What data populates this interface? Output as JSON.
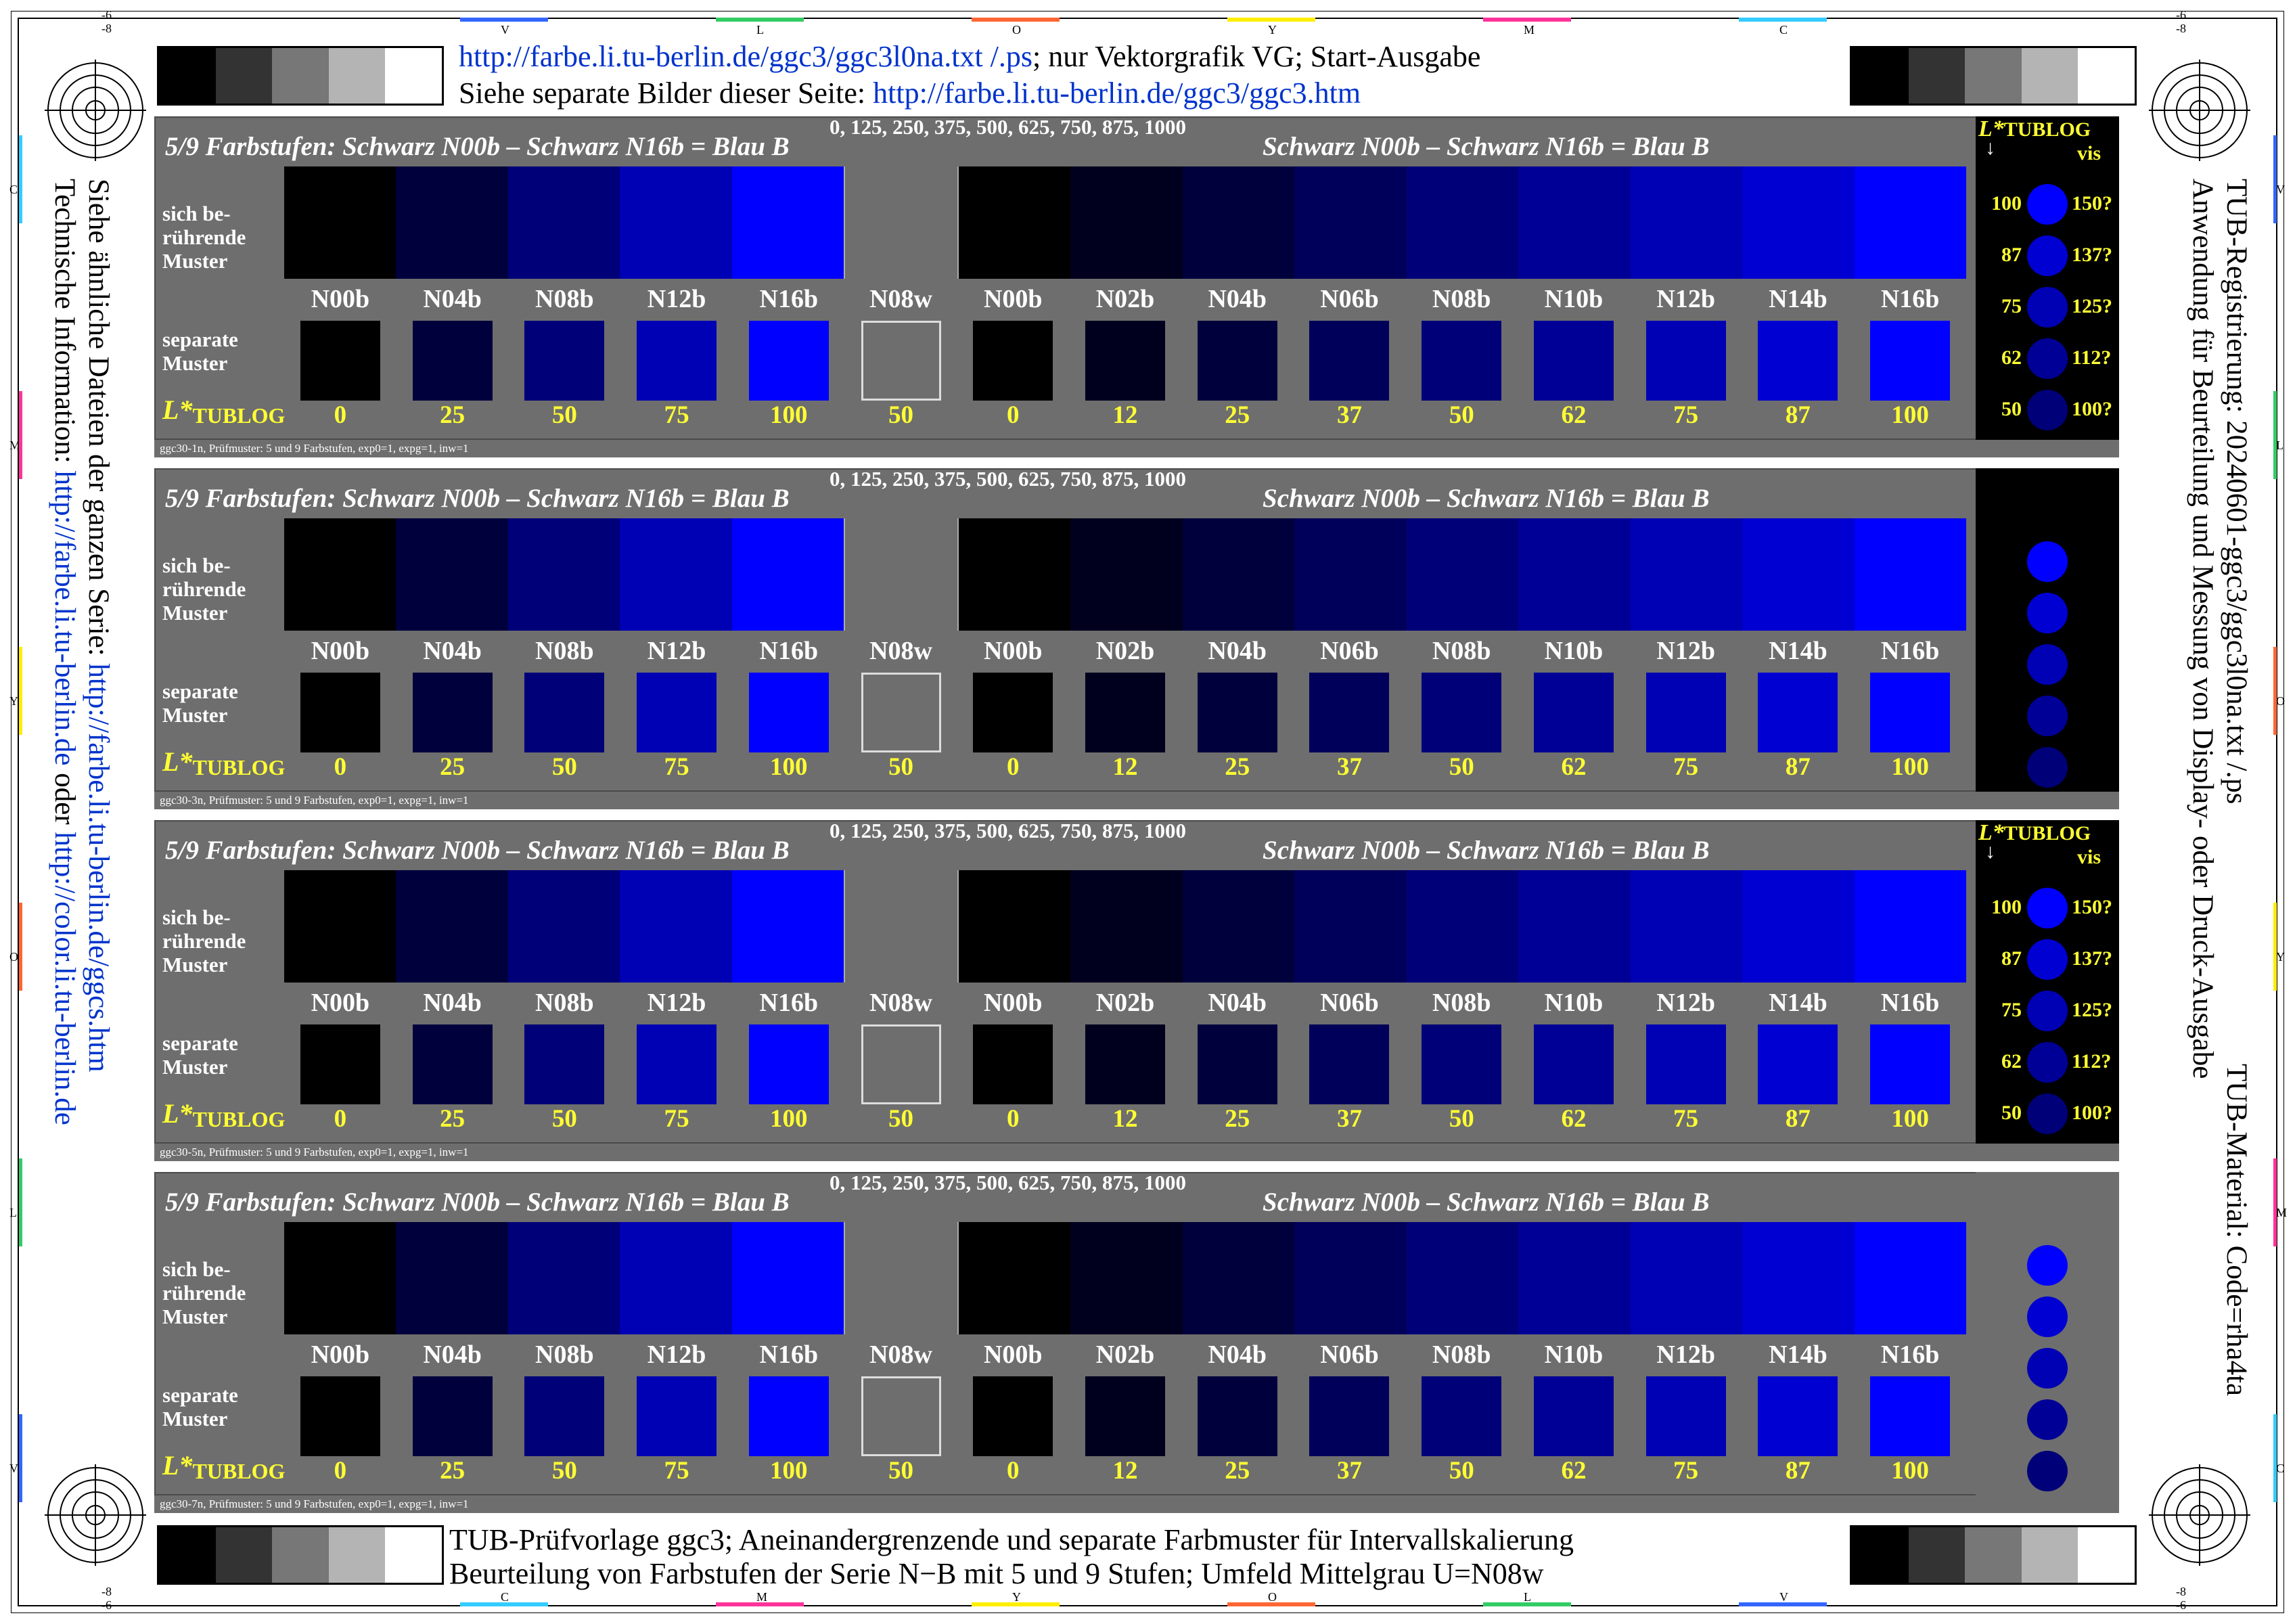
{
  "header": {
    "line1_link": "http://farbe.li.tu-berlin.de/ggc3/ggc3l0na.txt /.ps",
    "line1_rest": "; nur Vektorgrafik VG; Start-Ausgabe",
    "line2_text": "Siehe separate Bilder dieser Seite: ",
    "line2_link": "http://farbe.li.tu-berlin.de/ggc3/ggc3.htm"
  },
  "footer": {
    "line1": "TUB-Prüfvorlage ggc3; Aneinandergrenzende und separate Farbmuster für Intervallskalierung",
    "line2": "Beurteilung von Farbstufen der Serie N−B mit 5 und 9 Stufen; Umfeld Mittelgrau U=N08w"
  },
  "left_side": {
    "line1_text": "Siehe ähnliche Dateien der ganzen Serie: ",
    "line1_link": "http://farbe.li.tu-berlin.de/ggcs.htm",
    "line2_text": "Technische Information: ",
    "line2_link1": "http://farbe.li.tu-berlin.de",
    "line2_mid": " oder ",
    "line2_link2": "http://color.li.tu-berlin.de"
  },
  "right_side": {
    "line1": "TUB-Registrierung: 20240601-ggc3/ggc3l0na.txt /.ps",
    "line2": "Anwendung für Beurteilung und Messung von Display- oder Druck-Ausgabe",
    "line3": "TUB-Material: Code=rha4ta"
  },
  "marks": {
    "corner_a": "-6",
    "corner_b": "-8",
    "top_letters": [
      "V",
      "L",
      "O",
      "Y",
      "M",
      "C"
    ],
    "bottom_letters": [
      "C",
      "M",
      "Y",
      "O",
      "L",
      "V"
    ],
    "left_letters": [
      "C",
      "M",
      "Y",
      "O",
      "L",
      "V"
    ],
    "right_letters": [
      "V",
      "L",
      "O",
      "Y",
      "M",
      "C"
    ]
  },
  "panel_common": {
    "title_left": "5/9 Farbstufen:   Schwarz N00b – Schwarz N16b = Blau B",
    "title_right": "Schwarz N00b – Schwarz N16b = Blau B",
    "numbers": "0, 125, 250, 375, 500, 625, 750, 875, 1000",
    "label_contig": "sich be-\nrührende\nMuster",
    "label_sep": "separate\nMuster",
    "lstar_main": "L*",
    "lstar_sub": "TUBLOG",
    "labels": [
      "N00b",
      "N04b",
      "N08b",
      "N12b",
      "N16b",
      "N08w",
      "N00b",
      "N02b",
      "N04b",
      "N06b",
      "N08b",
      "N10b",
      "N12b",
      "N14b",
      "N16b"
    ],
    "values": [
      "0",
      "25",
      "50",
      "75",
      "100",
      "50",
      "0",
      "12",
      "25",
      "37",
      "50",
      "62",
      "75",
      "87",
      "100"
    ],
    "colors": [
      "#000000",
      "#00003c",
      "#000078",
      "#0000b4",
      "#0000ff",
      "#6e6e6e",
      "#000000",
      "#00001e",
      "#00003c",
      "#00005a",
      "#000078",
      "#000096",
      "#0000b4",
      "#0000d2",
      "#0000ff"
    ]
  },
  "panels": [
    {
      "footnote": "ggc30-1n, Prüfmuster: 5 und 9 Farbstufen, exp0=1, expg=1, inw=1",
      "side_labels": true
    },
    {
      "footnote": "ggc30-3n, Prüfmuster: 5 und 9 Farbstufen, exp0=1, expg=1, inw=1",
      "side_labels": false
    },
    {
      "footnote": "ggc30-5n, Prüfmuster: 5 und 9 Farbstufen, exp0=1, expg=1, inw=1",
      "side_labels": true
    },
    {
      "footnote": "ggc30-7n, Prüfmuster: 5 und 9 Farbstufen, exp0=1, expg=1, inw=1",
      "side_labels": false
    }
  ],
  "sidebox": {
    "title_main": "L*",
    "title_sub": "TUBLOG",
    "vis": "vis",
    "arrow": "↓",
    "left_vals": [
      "100",
      "87",
      "75",
      "62",
      "50"
    ],
    "right_vals": [
      "150?",
      "137?",
      "125?",
      "112?",
      "100?"
    ],
    "circle_colors_a": [
      "#0000ff",
      "#0000d2",
      "#0000b4",
      "#000096",
      "#000078"
    ],
    "circle_colors_b": [
      "#0000ff",
      "#0000d2",
      "#0000b4",
      "#000096",
      "#000078"
    ]
  },
  "gray_scale": [
    "#000000",
    "#333333",
    "#777777",
    "#b4b4b4",
    "#ffffff"
  ]
}
